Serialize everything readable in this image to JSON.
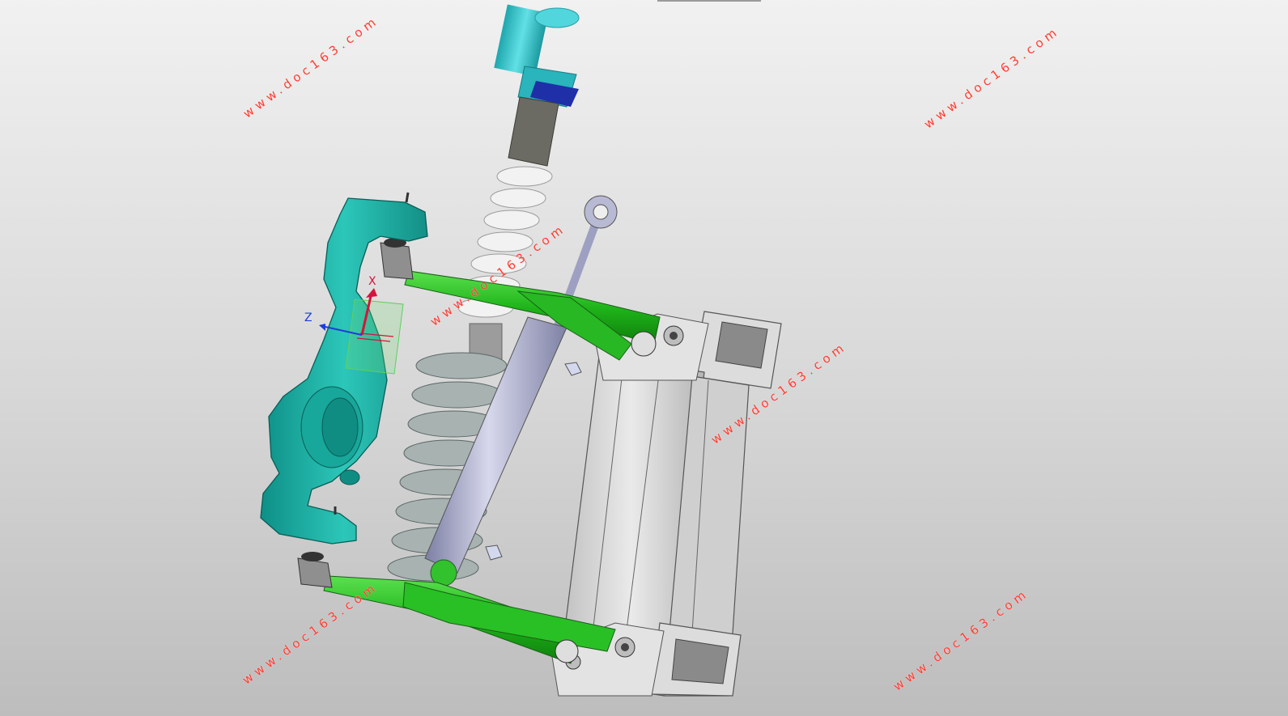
{
  "viewport": {
    "background": "#d9d9d9"
  },
  "triad": {
    "x_label": "X",
    "z_label": "Z",
    "x_color": "#d4143a",
    "z_color": "#1f3ddb"
  },
  "watermarks": [
    {
      "text": "www.doc163.com"
    },
    {
      "text": "www.doc163.com"
    },
    {
      "text": "www.doc163.com"
    },
    {
      "text": "www.doc163.com"
    },
    {
      "text": "www.doc163.com"
    },
    {
      "text": "www.doc163.com"
    }
  ],
  "colors": {
    "knuckle": "#1fb5a8",
    "control_arm": "#22c41f",
    "frame": "#d4d4d4",
    "damper_body": "#a9abc9",
    "spring_top": "#ececec",
    "spring_bottom": "#9aa6a5",
    "reservoir": "#3ccbd1",
    "watermark": "#ff3b30"
  }
}
